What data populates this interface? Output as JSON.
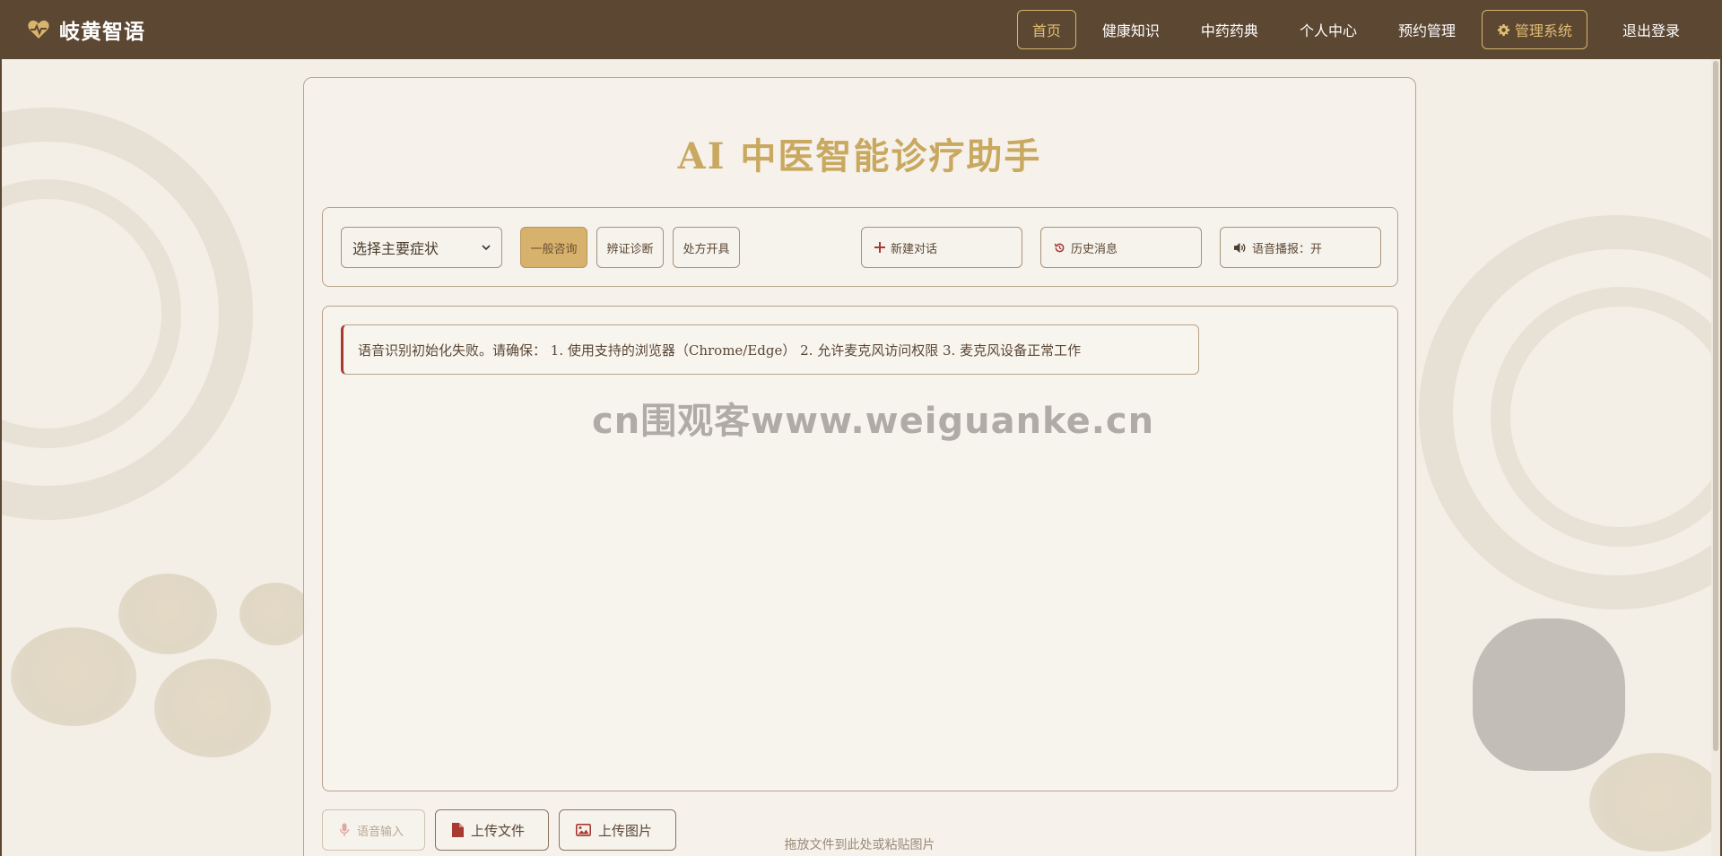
{
  "brand": {
    "name": "岐黄智语",
    "icon": "heart-pulse-icon"
  },
  "nav": [
    {
      "label": "首页",
      "active": true
    },
    {
      "label": "健康知识"
    },
    {
      "label": "中药药典"
    },
    {
      "label": "个人中心"
    },
    {
      "label": "预约管理"
    },
    {
      "label": "管理系统",
      "icon": "gear-icon"
    },
    {
      "label": "退出登录"
    }
  ],
  "page": {
    "title": "AI 中医智能诊疗助手"
  },
  "toolbar": {
    "symptom_select": "选择主要症状",
    "modes": [
      "一般咨询",
      "辨证诊断",
      "处方开具"
    ],
    "new_chat": "新建对话",
    "history": "历史消息",
    "voice_broadcast": "语音播报：开"
  },
  "chat": {
    "alert": "语音识别初始化失败。请确保： 1. 使用支持的浏览器（Chrome/Edge） 2. 允许麦克风访问权限 3. 麦克风设备正常工作",
    "watermark": "cn围观客www.weiguanke.cn"
  },
  "bottom": {
    "voice_input": "语音输入",
    "upload_file": "上传文件",
    "upload_image": "上传图片",
    "drop_hint": "拖放文件到此处或粘贴图片"
  },
  "colors": {
    "header": "#5c4733",
    "accent_gold": "#c9a860",
    "active_mode": "#d7b26c",
    "alert_border": "#a83a32",
    "icon_red": "#a83a32"
  }
}
